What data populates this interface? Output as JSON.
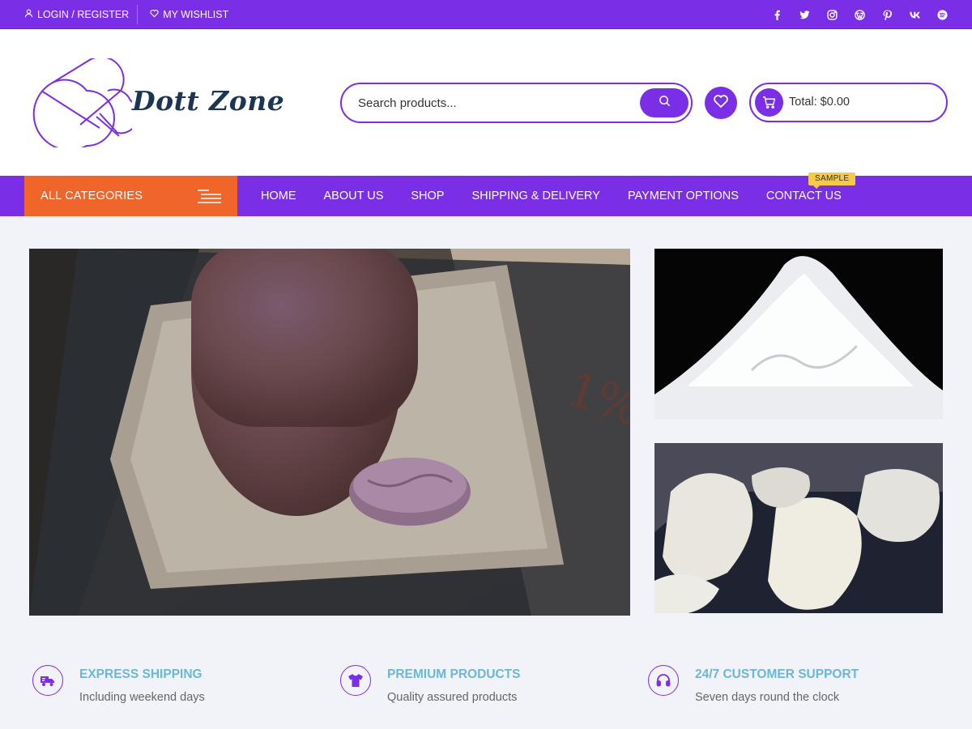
{
  "topbar": {
    "login_label": "LOGIN / REGISTER",
    "wishlist_label": "MY WISHLIST",
    "socials": [
      "facebook-icon",
      "twitter-icon",
      "instagram-icon",
      "wordpress-icon",
      "pinterest-icon",
      "vk-icon",
      "spotify-icon"
    ]
  },
  "header": {
    "logo_text": "Dott Zone",
    "search_placeholder": "Search products...",
    "cart_total": "Total: $0.00"
  },
  "nav": {
    "categories_label": "ALL CATEGORIES",
    "items": [
      "HOME",
      "ABOUT US",
      "SHOP",
      "SHIPPING & DELIVERY",
      "PAYMENT OPTIONS",
      "CONTACT US"
    ],
    "badge": "SAMPLE"
  },
  "features": [
    {
      "title": "EXPRESS SHIPPING",
      "subtitle": "Including weekend days",
      "icon": "truck-icon"
    },
    {
      "title": "PREMIUM PRODUCTS",
      "subtitle": "Quality assured products",
      "icon": "tshirt-icon"
    },
    {
      "title": "24/7 CUSTOMER SUPPORT",
      "subtitle": "Seven days round the clock",
      "icon": "headset-icon"
    }
  ],
  "colors": {
    "primary": "#7a2ee6",
    "accent": "#f0662a",
    "badge": "#f7c948",
    "feature_title": "#6cb7d8",
    "logo_text": "#1c3557"
  }
}
